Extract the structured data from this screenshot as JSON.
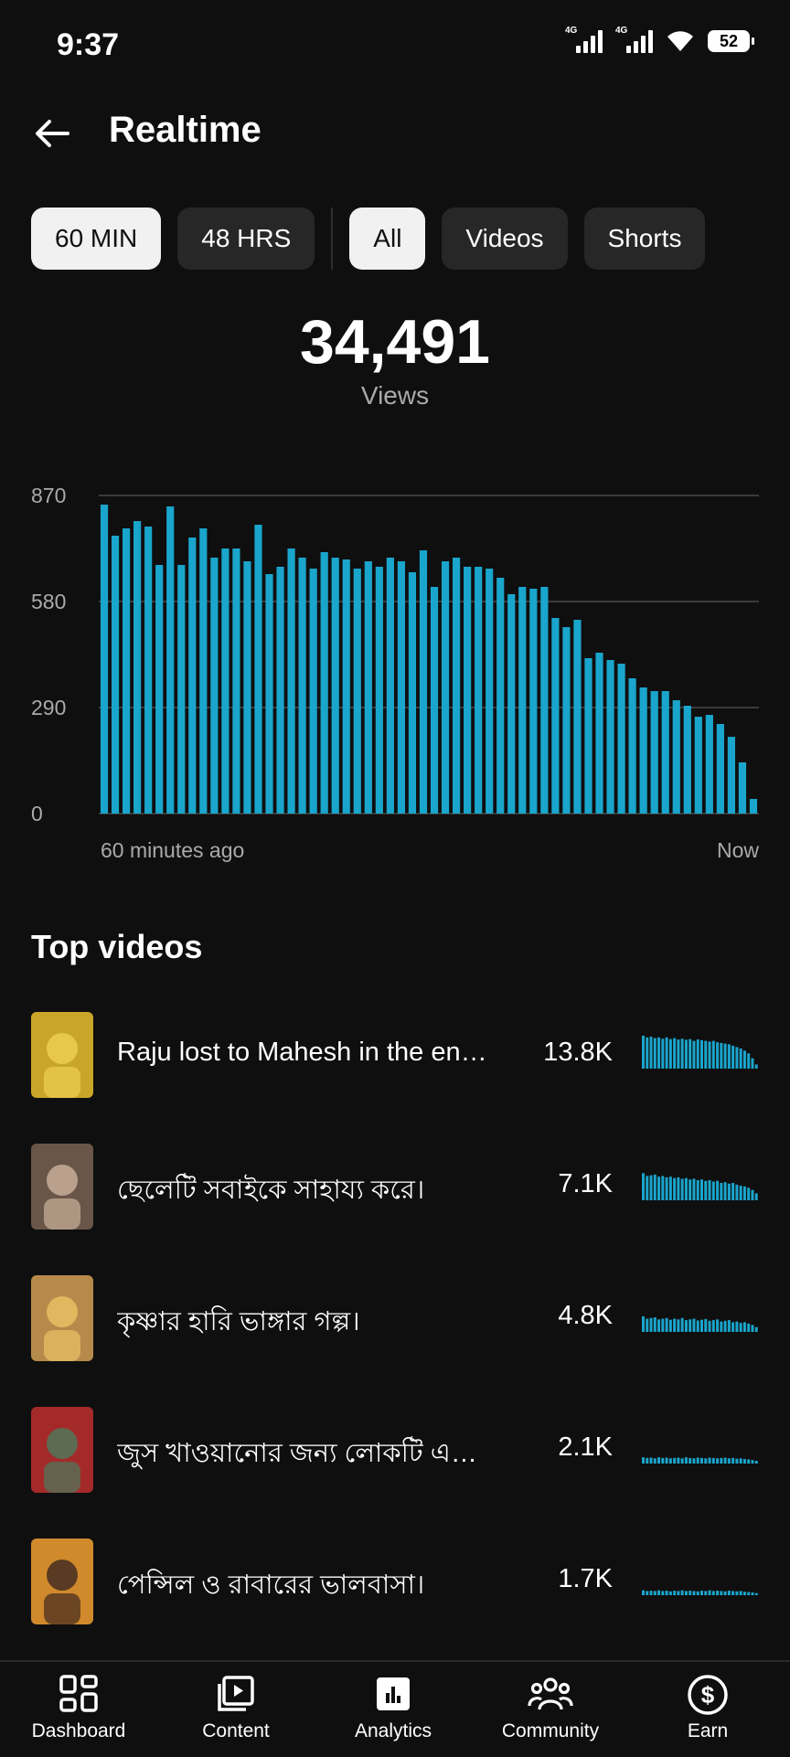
{
  "status_bar": {
    "time": "9:37",
    "signal1_label": "4G",
    "signal2_label": "4G",
    "battery": "52"
  },
  "header": {
    "title": "Realtime"
  },
  "chips": {
    "min60": "60 MIN",
    "hrs48": "48 HRS",
    "all": "All",
    "videos": "Videos",
    "shorts": "Shorts"
  },
  "summary": {
    "total": "34,491",
    "label": "Views"
  },
  "chart_data": {
    "type": "bar",
    "title": "",
    "xlabel": "",
    "ylabel": "",
    "y_ticks": [
      "870",
      "580",
      "290",
      "0"
    ],
    "ylim": [
      0,
      870
    ],
    "x_start_label": "60 minutes ago",
    "x_end_label": "Now",
    "color": "#1aa5cc",
    "grid": true,
    "values": [
      845,
      760,
      780,
      800,
      785,
      680,
      840,
      680,
      755,
      780,
      700,
      725,
      725,
      690,
      790,
      655,
      675,
      725,
      700,
      670,
      715,
      700,
      695,
      670,
      690,
      675,
      700,
      690,
      660,
      720,
      620,
      690,
      700,
      675,
      675,
      670,
      645,
      600,
      620,
      615,
      620,
      535,
      510,
      530,
      425,
      440,
      420,
      410,
      370,
      345,
      335,
      335,
      310,
      295,
      265,
      270,
      245,
      210,
      140,
      40
    ]
  },
  "top_videos": {
    "title": "Top videos",
    "items": [
      {
        "title": "Raju lost to Mahesh in the en…",
        "views": "13.8K",
        "thumb_bg": "#c9a62a",
        "thumb_fg": "#e8c84a",
        "spark": [
          0.95,
          0.9,
          0.92,
          0.88,
          0.9,
          0.86,
          0.9,
          0.85,
          0.88,
          0.84,
          0.86,
          0.83,
          0.85,
          0.8,
          0.84,
          0.82,
          0.8,
          0.78,
          0.8,
          0.76,
          0.74,
          0.72,
          0.7,
          0.66,
          0.62,
          0.58,
          0.52,
          0.44,
          0.3,
          0.12
        ]
      },
      {
        "title": "ছেলেটি সবাইকে সাহায্য করে।",
        "views": "7.1K",
        "thumb_bg": "#6a5648",
        "thumb_fg": "#b9a18d",
        "spark": [
          0.78,
          0.7,
          0.72,
          0.74,
          0.68,
          0.7,
          0.66,
          0.68,
          0.64,
          0.66,
          0.62,
          0.64,
          0.6,
          0.62,
          0.58,
          0.6,
          0.56,
          0.58,
          0.54,
          0.56,
          0.5,
          0.52,
          0.48,
          0.5,
          0.45,
          0.42,
          0.4,
          0.36,
          0.3,
          0.2
        ]
      },
      {
        "title": "কৃষ্ণার হারি ভাঙ্গার গল্প।",
        "views": "4.8K",
        "thumb_bg": "#b68a4a",
        "thumb_fg": "#e0b860",
        "spark": [
          0.45,
          0.38,
          0.4,
          0.42,
          0.36,
          0.38,
          0.4,
          0.35,
          0.38,
          0.36,
          0.4,
          0.34,
          0.36,
          0.38,
          0.33,
          0.35,
          0.37,
          0.32,
          0.34,
          0.36,
          0.3,
          0.32,
          0.34,
          0.28,
          0.3,
          0.26,
          0.28,
          0.24,
          0.2,
          0.14
        ]
      },
      {
        "title": "জুস খাওয়ানোর জন্য লোকটি এ…",
        "views": "2.1K",
        "thumb_bg": "#a42a2a",
        "thumb_fg": "#5c6b52",
        "spark": [
          0.18,
          0.16,
          0.17,
          0.15,
          0.18,
          0.16,
          0.17,
          0.15,
          0.16,
          0.17,
          0.15,
          0.18,
          0.16,
          0.15,
          0.17,
          0.16,
          0.15,
          0.17,
          0.16,
          0.15,
          0.16,
          0.17,
          0.15,
          0.16,
          0.14,
          0.15,
          0.13,
          0.12,
          0.1,
          0.08
        ]
      },
      {
        "title": "পেন্সিল ও রাবারের ভালবাসা।",
        "views": "1.7K",
        "thumb_bg": "#d08a2c",
        "thumb_fg": "#5a3a22",
        "spark": [
          0.14,
          0.12,
          0.13,
          0.12,
          0.14,
          0.12,
          0.13,
          0.11,
          0.13,
          0.12,
          0.14,
          0.12,
          0.13,
          0.12,
          0.11,
          0.13,
          0.12,
          0.14,
          0.12,
          0.13,
          0.12,
          0.11,
          0.13,
          0.12,
          0.11,
          0.12,
          0.1,
          0.09,
          0.08,
          0.06
        ]
      }
    ]
  },
  "bottom_nav": {
    "dashboard": "Dashboard",
    "content": "Content",
    "analytics": "Analytics",
    "community": "Community",
    "earn": "Earn"
  }
}
